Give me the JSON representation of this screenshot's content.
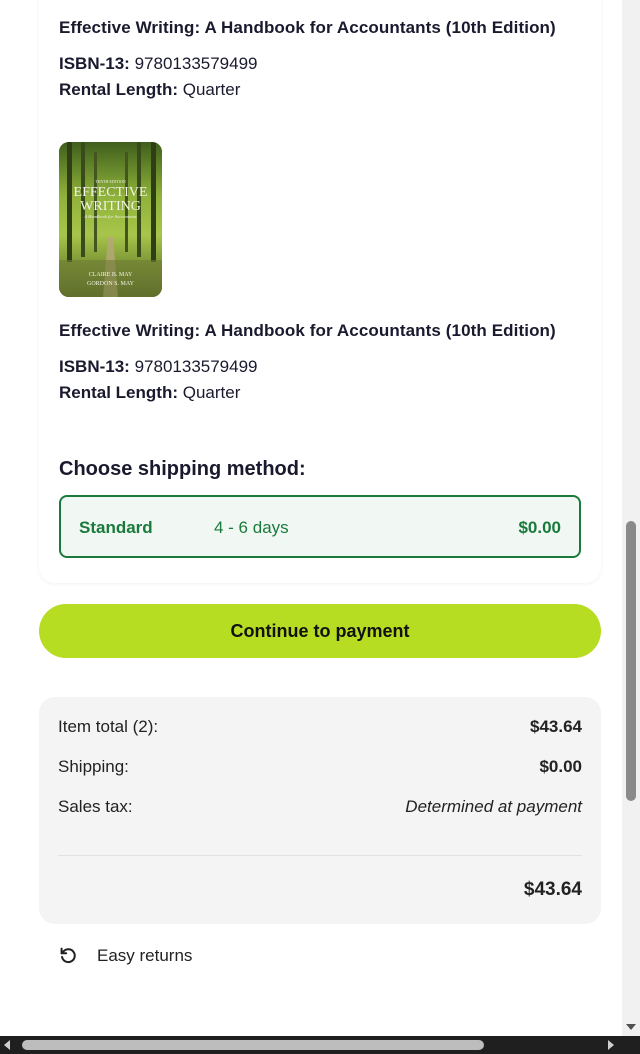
{
  "items": [
    {
      "title": "Effective Writing: A Handbook for Accountants (10th Edition)",
      "isbn_label": "ISBN-13:",
      "isbn": "9780133579499",
      "rental_label": "Rental Length:",
      "rental": "Quarter"
    },
    {
      "title": "Effective Writing: A Handbook for Accountants (10th Edition)",
      "isbn_label": "ISBN-13:",
      "isbn": "9780133579499",
      "rental_label": "Rental Length:",
      "rental": "Quarter",
      "cover": {
        "edition_text": "TENTH EDITION",
        "title_line1": "EFFECTIVE",
        "title_line2": "WRITING",
        "subtitle": "A Handbook for Accountants",
        "author1": "CLAIRE B. MAY",
        "author2": "GORDON S. MAY"
      }
    }
  ],
  "shipping": {
    "heading": "Choose shipping method:",
    "option": {
      "name": "Standard",
      "days": "4 - 6 days",
      "price": "$0.00"
    },
    "accent_color": "#1a7a3c"
  },
  "continue_button": {
    "label": "Continue to payment",
    "color": "#b7dd22"
  },
  "summary": {
    "item_total_label": "Item total (2):",
    "item_total": "$43.64",
    "shipping_label": "Shipping:",
    "shipping": "$0.00",
    "tax_label": "Sales tax:",
    "tax": "Determined at payment",
    "total": "$43.64"
  },
  "returns": {
    "label": "Easy returns",
    "icon": "undo-icon"
  }
}
